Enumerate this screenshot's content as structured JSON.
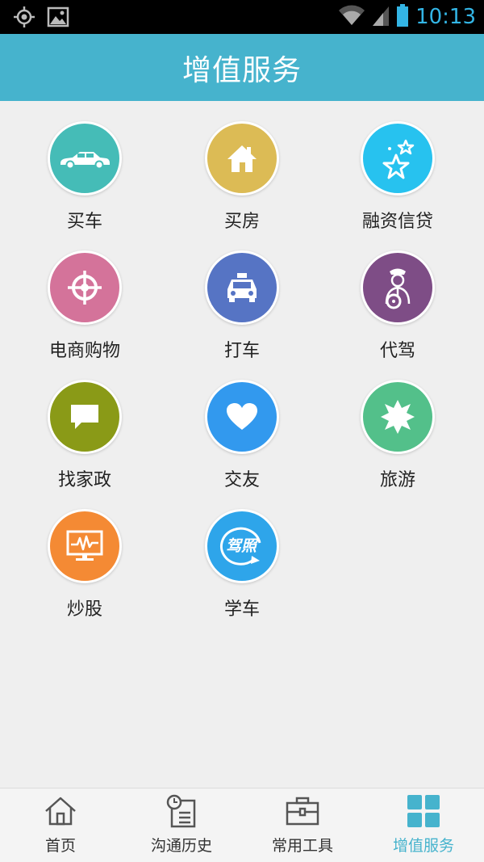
{
  "status_bar": {
    "time": "10:13",
    "icons": [
      "gps-icon",
      "image-notification-icon",
      "wifi-icon",
      "signal-icon",
      "battery-icon"
    ]
  },
  "header": {
    "title": "增值服务"
  },
  "services": [
    {
      "label": "买车",
      "icon": "car-icon",
      "color": "#45bcb7"
    },
    {
      "label": "买房",
      "icon": "house-icon",
      "color": "#dcbb55"
    },
    {
      "label": "融资信贷",
      "icon": "stars-icon",
      "color": "#27c2ef"
    },
    {
      "label": "电商购物",
      "icon": "crosshair-icon",
      "color": "#d4739a"
    },
    {
      "label": "打车",
      "icon": "taxi-icon",
      "color": "#5674c4"
    },
    {
      "label": "代驾",
      "icon": "driver-icon",
      "color": "#7e4d86"
    },
    {
      "label": "找家政",
      "icon": "chat-bubble-icon",
      "color": "#8a9a17"
    },
    {
      "label": "交友",
      "icon": "heart-icon",
      "color": "#3299ee"
    },
    {
      "label": "旅游",
      "icon": "star-badge-icon",
      "color": "#53c08a"
    },
    {
      "label": "炒股",
      "icon": "stock-monitor-icon",
      "color": "#f48a34"
    },
    {
      "label": "学车",
      "icon": "driving-license-icon",
      "color": "#2ea5ea",
      "badge_text": "驾照"
    }
  ],
  "tabs": [
    {
      "label": "首页",
      "icon": "home-icon",
      "active": false
    },
    {
      "label": "沟通历史",
      "icon": "history-icon",
      "active": false
    },
    {
      "label": "常用工具",
      "icon": "toolbox-icon",
      "active": false
    },
    {
      "label": "增值服务",
      "icon": "grid-icon",
      "active": true
    }
  ],
  "colors": {
    "accent": "#46b3cd",
    "status_time": "#33b5e5",
    "background": "#efefef",
    "tab_inactive": "#555555"
  }
}
